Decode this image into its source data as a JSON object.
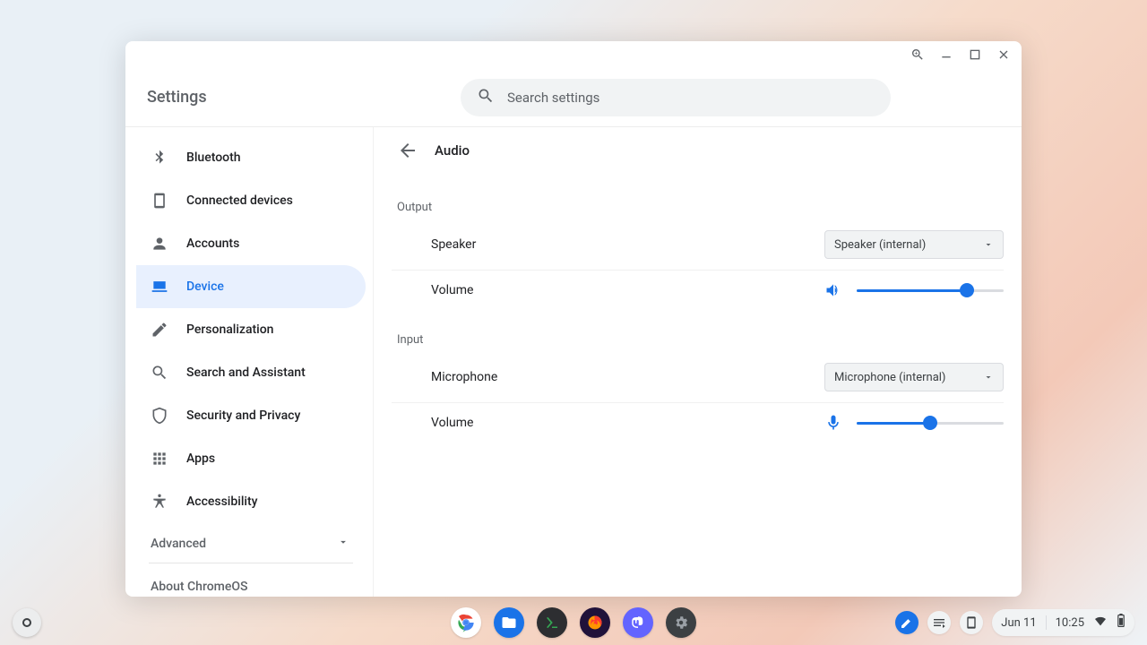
{
  "header": {
    "title": "Settings",
    "search_placeholder": "Search settings"
  },
  "sidebar": {
    "items": [
      {
        "label": "Bluetooth"
      },
      {
        "label": "Connected devices"
      },
      {
        "label": "Accounts"
      },
      {
        "label": "Device"
      },
      {
        "label": "Personalization"
      },
      {
        "label": "Search and Assistant"
      },
      {
        "label": "Security and Privacy"
      },
      {
        "label": "Apps"
      },
      {
        "label": "Accessibility"
      }
    ],
    "advanced_label": "Advanced",
    "about_label": "About ChromeOS"
  },
  "page": {
    "title": "Audio",
    "output": {
      "section_label": "Output",
      "speaker_label": "Speaker",
      "speaker_dropdown_value": "Speaker (internal)",
      "volume_label": "Volume",
      "volume_percent": 75
    },
    "input": {
      "section_label": "Input",
      "mic_label": "Microphone",
      "mic_dropdown_value": "Microphone (internal)",
      "volume_label": "Volume",
      "volume_percent": 50
    }
  },
  "shelf": {
    "date": "Jun 11",
    "time": "10:25"
  },
  "colors": {
    "accent": "#1a73e8"
  }
}
